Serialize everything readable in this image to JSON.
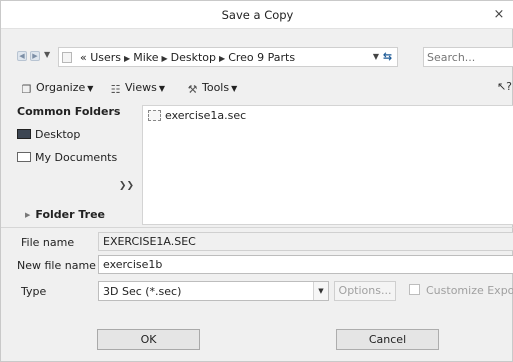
{
  "window": {
    "title": "Save a Copy",
    "close_glyph": "×"
  },
  "address": {
    "crumbs_prefix": "«",
    "crumbs": [
      "Users",
      "Mike",
      "Desktop",
      "Creo 9 Parts"
    ],
    "search_placeholder": "Search..."
  },
  "toolbar": {
    "organize": "Organize",
    "views": "Views",
    "tools": "Tools",
    "help_glyph": "?"
  },
  "sidebar": {
    "header": "Common Folders",
    "items": [
      {
        "label": "Desktop",
        "icon": "desktop-icon"
      },
      {
        "label": "My Documents",
        "icon": "documents-icon"
      }
    ],
    "folder_tree": "Folder Tree"
  },
  "files": [
    {
      "name": "exercise1a.sec",
      "icon": "section-file-icon"
    }
  ],
  "form": {
    "file_name_label": "File name",
    "file_name_value": "EXERCISE1A.SEC",
    "new_file_name_label": "New file name",
    "new_file_name_value": "exercise1b",
    "type_label": "Type",
    "type_value": "3D Sec (*.sec)",
    "options_label": "Options...",
    "customize_export_label": "Customize Export"
  },
  "buttons": {
    "ok": "OK",
    "cancel": "Cancel"
  },
  "colors": {
    "background": "#f0f0f0",
    "pane": "#ffffff",
    "disabled_text": "#a0a0a0"
  }
}
